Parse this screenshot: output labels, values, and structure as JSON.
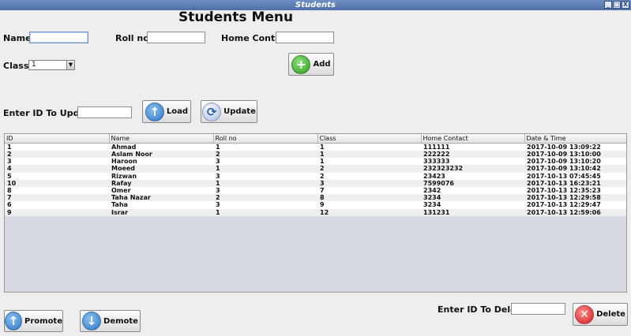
{
  "window": {
    "title": "Students",
    "controls": [
      "_",
      "□",
      "X"
    ]
  },
  "page_title": "Students Menu",
  "form": {
    "name_label": "Name",
    "name_value": "",
    "rollno_label": "Roll no",
    "rollno_value": "",
    "contact_label": "Home Contact",
    "contact_value": "",
    "class_label": "Class",
    "class_selected": "1",
    "add_label": "Add"
  },
  "update": {
    "label": "Enter ID To Update",
    "value": "",
    "load_label": "Load",
    "update_label": "Update"
  },
  "table": {
    "columns": [
      "ID",
      "Name",
      "Roll no",
      "Class",
      "Home Contact",
      "Date & Time"
    ],
    "rows": [
      [
        "1",
        "Ahmad",
        "1",
        "1",
        "111111",
        "2017-10-09 13:09:22"
      ],
      [
        "2",
        "Aslam Noor",
        "2",
        "1",
        "222222",
        "2017-10-09 13:10:00"
      ],
      [
        "3",
        "Haroon",
        "3",
        "1",
        "333333",
        "2017-10-09 13:10:20"
      ],
      [
        "4",
        "Moeed",
        "1",
        "2",
        "232323232",
        "2017-10-09 13:10:42"
      ],
      [
        "5",
        "Rizwan",
        "3",
        "2",
        "23423",
        "2017-10-13 07:45:45"
      ],
      [
        "10",
        "Rafay",
        "1",
        "3",
        "7599076",
        "2017-10-13 16:23:21"
      ],
      [
        "8",
        "Omer",
        "3",
        "7",
        "2342",
        "2017-10-13 12:35:23"
      ],
      [
        "7",
        "Taha Nazar",
        "2",
        "8",
        "3234",
        "2017-10-13 12:29:58"
      ],
      [
        "6",
        "Taha",
        "3",
        "9",
        "3234",
        "2017-10-13 12:29:47"
      ],
      [
        "9",
        "Israr",
        "1",
        "12",
        "131231",
        "2017-10-13 12:59:06"
      ]
    ]
  },
  "bottom": {
    "promote_label": "Promote",
    "demote_label": "Demote",
    "delete_id_label": "Enter ID To Delete",
    "delete_value": "",
    "delete_label": "Delete"
  }
}
